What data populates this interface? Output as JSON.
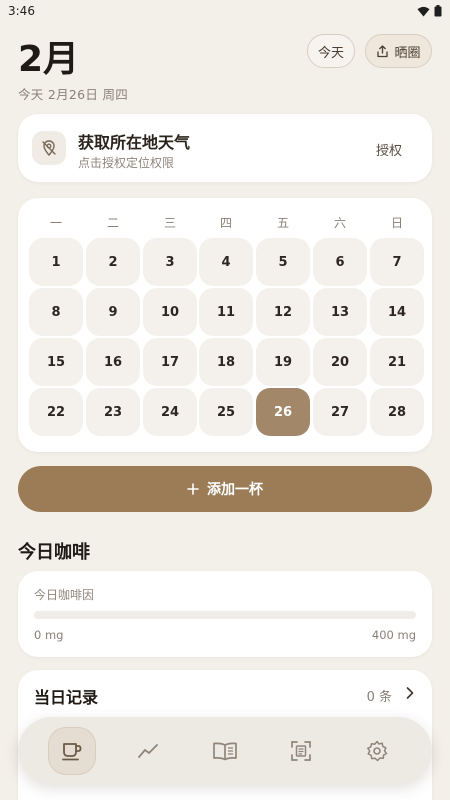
{
  "status_bar": {
    "time": "3:46"
  },
  "header": {
    "month": "2月",
    "date_line": "今天 2月26日 周四",
    "today_button": "今天",
    "share_button": "晒圈"
  },
  "weather": {
    "title": "获取所在地天气",
    "subtitle": "点击授权定位权限",
    "auth_label": "授权"
  },
  "calendar": {
    "weekdays": [
      "一",
      "二",
      "三",
      "四",
      "五",
      "六",
      "日"
    ],
    "days": [
      "1",
      "2",
      "3",
      "4",
      "5",
      "6",
      "7",
      "8",
      "9",
      "10",
      "11",
      "12",
      "13",
      "14",
      "15",
      "16",
      "17",
      "18",
      "19",
      "20",
      "21",
      "22",
      "23",
      "24",
      "25",
      "26",
      "27",
      "28"
    ],
    "selected_day": "26"
  },
  "add_button": {
    "label": "添加一杯"
  },
  "today_coffee": {
    "section_title": "今日咖啡",
    "caffeine_label": "今日咖啡因",
    "progress_fraction": 0,
    "min_label": "0 mg",
    "max_label": "400 mg"
  },
  "records": {
    "title": "当日记录",
    "count": "0 条"
  },
  "nav": {
    "items": [
      "cup-icon",
      "trend-icon",
      "book-icon",
      "scan-icon",
      "settings-icon"
    ],
    "active": "cup-icon"
  },
  "colors": {
    "accent": "#9b7c57",
    "selected_day": "#a28868",
    "background": "#f3efe9"
  }
}
